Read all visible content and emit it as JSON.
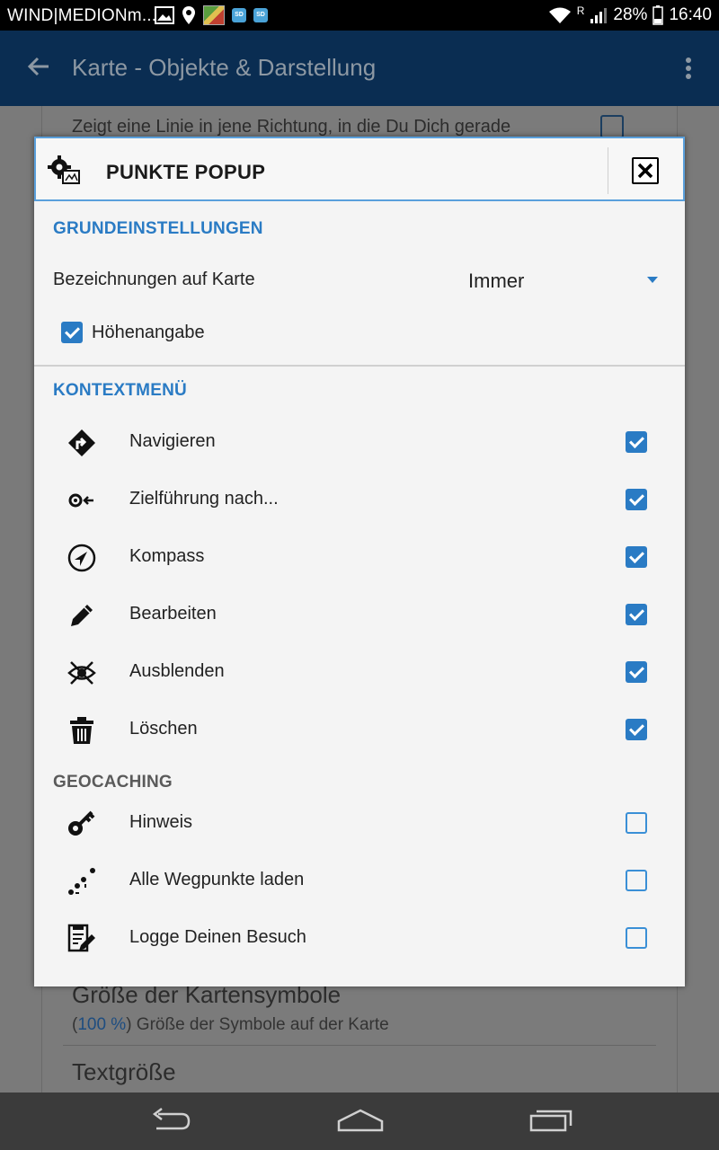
{
  "status_bar": {
    "carrier": "WIND|MEDIONm...",
    "roaming": "R",
    "battery": "28%",
    "time": "16:40"
  },
  "app_bar": {
    "title": "Karte - Objekte & Darstellung"
  },
  "background": {
    "line1": "Zeigt eine Linie in jene Richtung, in die Du Dich gerade",
    "setting_title": "Größe der Kartensymbole",
    "setting_sub_pct": "100 %",
    "setting_sub_open": "(",
    "setting_sub_rest": ") Größe der Symbole auf der Karte",
    "setting_title2": "Textgröße"
  },
  "dialog": {
    "title": "PUNKTE POPUP",
    "section_basic": "GRUNDEINSTELLUNGEN",
    "labels_on_map": "Bezeichnungen auf Karte",
    "labels_on_map_value": "Immer",
    "altitude_label": "Höhenangabe",
    "altitude_checked": true,
    "section_context": "KONTEXTMENÜ",
    "context_items": [
      {
        "label": "Navigieren",
        "icon": "navigate-icon",
        "checked": true
      },
      {
        "label": "Zielführung nach...",
        "icon": "guide-to-icon",
        "checked": true
      },
      {
        "label": "Kompass",
        "icon": "compass-icon",
        "checked": true
      },
      {
        "label": "Bearbeiten",
        "icon": "pencil-icon",
        "checked": true
      },
      {
        "label": "Ausblenden",
        "icon": "hide-icon",
        "checked": true
      },
      {
        "label": "Löschen",
        "icon": "trash-icon",
        "checked": true
      }
    ],
    "section_geocaching": "GEOCACHING",
    "geocaching_items": [
      {
        "label": "Hinweis",
        "icon": "key-icon",
        "checked": false
      },
      {
        "label": "Alle Wegpunkte laden",
        "icon": "waypoints-icon",
        "checked": false
      },
      {
        "label": "Logge Deinen Besuch",
        "icon": "log-visit-icon",
        "checked": false
      }
    ]
  },
  "colors": {
    "accent": "#2a7bc4",
    "header_border": "#5aa0dc",
    "appbar": "#0a2d52"
  }
}
